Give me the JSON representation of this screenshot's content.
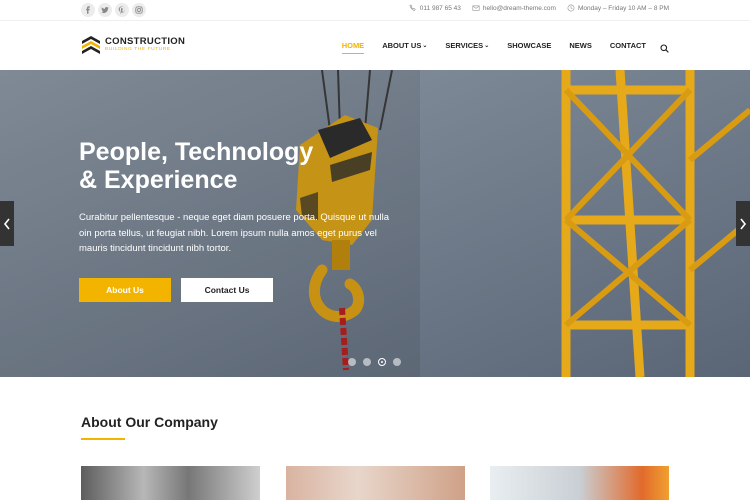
{
  "social": {
    "icons": [
      "facebook-icon",
      "twitter-icon",
      "pinterest-icon",
      "instagram-icon"
    ]
  },
  "contacts": {
    "phone": "011 987 65 43",
    "email": "hello@dream-theme.com",
    "hours": "Monday – Friday 10 AM – 8 PM"
  },
  "logo": {
    "name": "CONSTRUCTION",
    "tagline": "BUILDING THE FUTURE"
  },
  "nav": {
    "items": [
      {
        "label": "HOME",
        "caret": ""
      },
      {
        "label": "ABOUT US",
        "caret": "›"
      },
      {
        "label": "SERVICES",
        "caret": "›"
      },
      {
        "label": "SHOWCASE",
        "caret": ""
      },
      {
        "label": "NEWS",
        "caret": ""
      },
      {
        "label": "CONTACT",
        "caret": ""
      }
    ]
  },
  "hero": {
    "title_line1": "People, Technology",
    "title_line2": "& Experience",
    "text": "Curabitur pellentesque - neque eget diam posuere porta. Quisque ut nulla oin porta tellus, ut feugiat nibh. Lorem ipsum nulla amos eget purus vel mauris tincidunt tincidunt nibh tortor.",
    "primary_button": "About Us",
    "secondary_button": "Contact Us",
    "active_slide": 3,
    "slide_count": 4
  },
  "about": {
    "title": "About Our Company"
  },
  "colors": {
    "accent": "#f3b400",
    "dark": "#222222"
  }
}
